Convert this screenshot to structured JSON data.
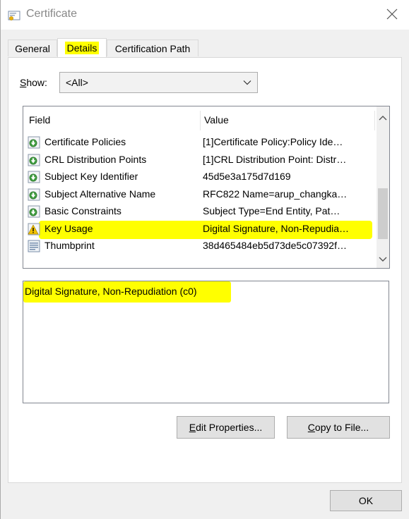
{
  "window": {
    "title": "Certificate"
  },
  "tabs": [
    {
      "label": "General",
      "active": false
    },
    {
      "label": "Details",
      "active": true
    },
    {
      "label": "Certification Path",
      "active": false
    }
  ],
  "show": {
    "label": "Show:",
    "value": "<All>"
  },
  "list": {
    "columns": [
      "Field",
      "Value"
    ],
    "rows": [
      {
        "icon": "certificate-extension-icon",
        "field": "Certificate Policies",
        "value": "[1]Certificate Policy:Policy Ide…"
      },
      {
        "icon": "certificate-extension-icon",
        "field": "CRL Distribution Points",
        "value": "[1]CRL Distribution Point: Distr…"
      },
      {
        "icon": "certificate-extension-icon",
        "field": "Subject Key Identifier",
        "value": "45d5e3a175d7d169"
      },
      {
        "icon": "certificate-extension-icon",
        "field": "Subject Alternative Name",
        "value": "RFC822 Name=arup_changka…"
      },
      {
        "icon": "certificate-extension-icon",
        "field": "Basic Constraints",
        "value": "Subject Type=End Entity, Pat…"
      },
      {
        "icon": "critical-extension-icon",
        "field": "Key Usage",
        "value": "Digital Signature, Non-Repudia…",
        "selected": true
      },
      {
        "icon": "thumbprint-icon",
        "field": "Thumbprint",
        "value": "38d465484eb5d73de5c07392f…"
      }
    ]
  },
  "detail_value": "Digital Signature, Non-Repudiation (c0)",
  "buttons": {
    "edit_properties": "Edit Properties...",
    "copy_to_file": "Copy to File...",
    "ok": "OK"
  },
  "colors": {
    "highlight": "#ffff00",
    "dialog_bg": "#f0f0f0",
    "button_bg": "#e1e1e1"
  }
}
